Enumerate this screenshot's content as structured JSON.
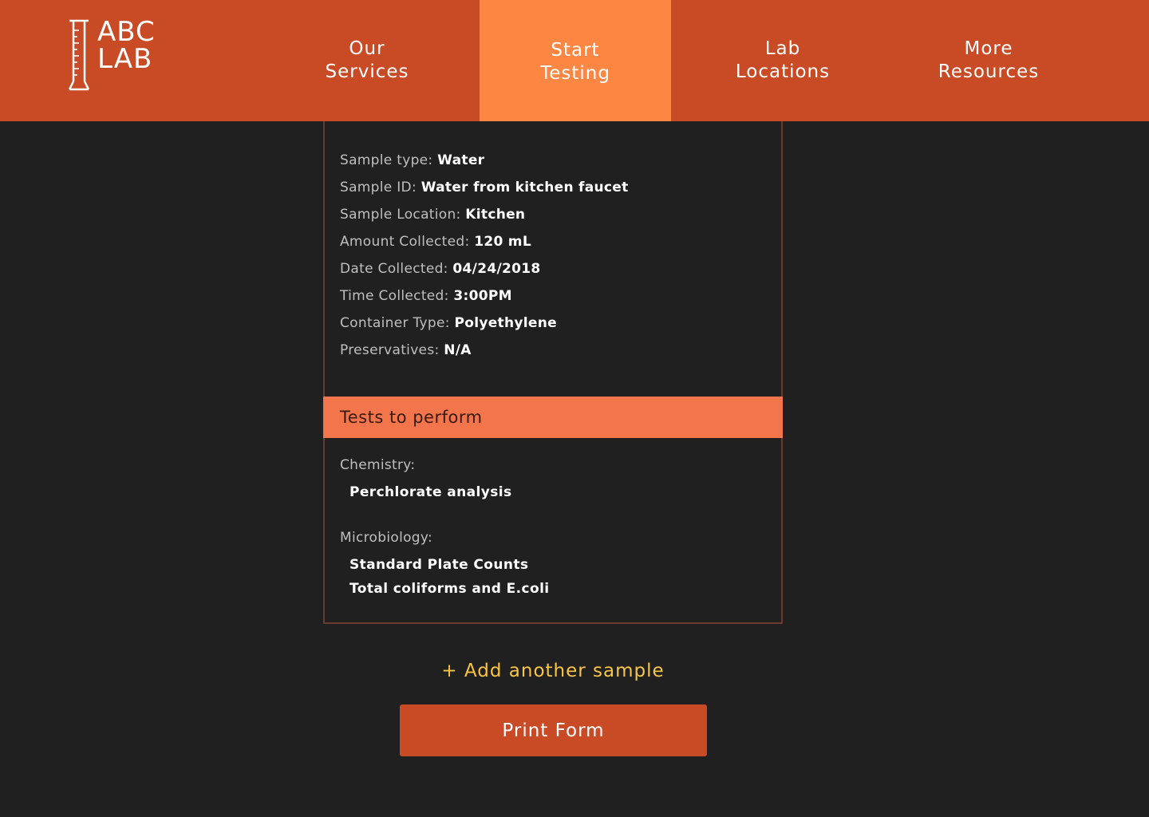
{
  "brand": {
    "line1": "ABC",
    "line2": "LAB",
    "logo_icon": "graduated-cylinder-icon"
  },
  "nav": {
    "items": [
      {
        "label": "Our\nServices",
        "active": false
      },
      {
        "label": "Start\nTesting",
        "active": true
      },
      {
        "label": "Lab\nLocations",
        "active": false
      },
      {
        "label": "More\nResources",
        "active": false
      }
    ]
  },
  "sample": {
    "fields": [
      {
        "label": "Sample type:",
        "value": "Water"
      },
      {
        "label": "Sample ID:",
        "value": "Water from kitchen faucet"
      },
      {
        "label": "Sample Location:",
        "value": "Kitchen"
      },
      {
        "label": "Amount Collected:",
        "value": "120 mL"
      },
      {
        "label": "Date Collected:",
        "value": "04/24/2018"
      },
      {
        "label": "Time Collected:",
        "value": "3:00PM"
      },
      {
        "label": "Container Type:",
        "value": "Polyethylene"
      },
      {
        "label": "Preservatives:",
        "value": "N/A"
      }
    ]
  },
  "tests": {
    "header": "Tests to perform",
    "groups": [
      {
        "label": "Chemistry:",
        "items": [
          "Perchlorate analysis"
        ]
      },
      {
        "label": "Microbiology:",
        "items": [
          "Standard Plate Counts",
          "Total coliforms and E.coli"
        ]
      }
    ]
  },
  "actions": {
    "add_sample": "+ Add another sample",
    "print_form": "Print Form"
  },
  "colors": {
    "header_bg": "#c94b25",
    "nav_active_bg": "#fd8742",
    "page_bg": "#202020",
    "tests_header_bg": "#f2754c",
    "link": "#f9c545"
  }
}
